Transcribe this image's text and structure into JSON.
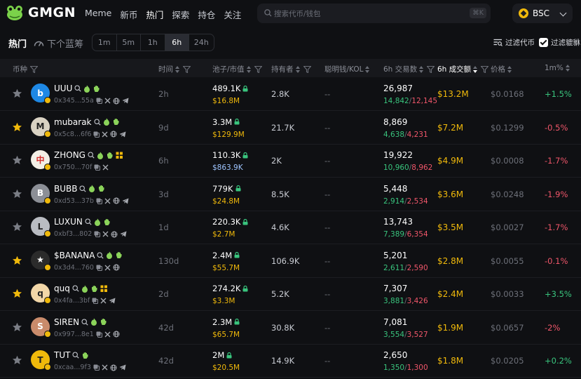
{
  "app": {
    "brand": "GMGN"
  },
  "nav": [
    "Meme",
    "新币",
    "热门",
    "探索",
    "持仓",
    "关注"
  ],
  "nav_active_index": 2,
  "search": {
    "placeholder": "搜索代币/钱包",
    "shortcut": "⌘K"
  },
  "chain": {
    "label": "BSC"
  },
  "subbar": {
    "tab_hot": "热门",
    "tab_next": "下个蓝筹",
    "time_filters": [
      "1m",
      "5m",
      "1h",
      "6h",
      "24h"
    ],
    "time_active": "6h",
    "filter_coins": "过滤代币",
    "filter_honeypot": "过滤貔貅",
    "filter_honeypot_checked": true
  },
  "columns": {
    "coin": "币种",
    "age": "时间",
    "liq_mcap": "池子/市值",
    "holders": "持有者",
    "smart_kol": "聪明钱/KOL",
    "txs": "6h 交易数",
    "volume": "6h 成交额",
    "price": "价格",
    "change": "1m%"
  },
  "colors": {
    "up": "#39c47d",
    "down": "#f0566a",
    "gold": "#f0b90b",
    "bg": "#0f1013"
  },
  "rows": [
    {
      "symbol": "UUU",
      "address": "0x345...55a",
      "age": "2h",
      "liquidity": "489.1K",
      "mcap": "$16.8M",
      "holders": "2.8K",
      "kol": "--",
      "txs": "26,987",
      "buys": "14,842",
      "sells": "12,145",
      "volume": "$13.2M",
      "price": "$0.0168",
      "change": "+1.5%",
      "change_dir": "up",
      "starred": false,
      "avatar_color": "#1e88e5",
      "avatar_text": "b"
    },
    {
      "symbol": "mubarak",
      "address": "0x5c8...6f6",
      "age": "9d",
      "liquidity": "3.3M",
      "mcap": "$129.9M",
      "holders": "21.7K",
      "kol": "--",
      "txs": "8,869",
      "buys": "4,638",
      "sells": "4,231",
      "volume": "$7.2M",
      "price": "$0.1299",
      "change": "-0.5%",
      "change_dir": "down",
      "starred": true,
      "avatar_color": "#d9d2c3",
      "avatar_text": "M"
    },
    {
      "symbol": "ZHONG",
      "address": "0x750...70f",
      "age": "6h",
      "liquidity": "110.3K",
      "mcap": "$863.9K",
      "mcap_blue": true,
      "holders": "2K",
      "kol": "--",
      "txs": "19,922",
      "buys": "10,960",
      "sells": "8,962",
      "volume": "$4.9M",
      "price": "$0.0008",
      "change": "-1.7%",
      "change_dir": "down",
      "starred": false,
      "avatar_color": "#f3efe6",
      "avatar_text": "中"
    },
    {
      "symbol": "BUBB",
      "address": "0xd53...37b",
      "age": "3d",
      "liquidity": "779K",
      "mcap": "$24.8M",
      "holders": "8.5K",
      "kol": "--",
      "txs": "5,448",
      "buys": "2,914",
      "sells": "2,534",
      "volume": "$3.6M",
      "price": "$0.0248",
      "change": "-1.9%",
      "change_dir": "down",
      "starred": false,
      "avatar_color": "#8c8f96",
      "avatar_text": "B"
    },
    {
      "symbol": "LUXUN",
      "address": "0xbf3...802",
      "age": "1d",
      "liquidity": "220.3K",
      "mcap": "$2.7M",
      "holders": "4.6K",
      "kol": "--",
      "txs": "13,743",
      "buys": "7,389",
      "sells": "6,354",
      "volume": "$3.5M",
      "price": "$0.0027",
      "change": "-1.7%",
      "change_dir": "down",
      "starred": false,
      "avatar_color": "#b9bcc2",
      "avatar_text": "L"
    },
    {
      "symbol": "$BANANA",
      "address": "0x3d4...760",
      "age": "130d",
      "liquidity": "2.4M",
      "mcap": "$55.7M",
      "holders": "106.9K",
      "kol": "--",
      "txs": "5,201",
      "buys": "2,611",
      "sells": "2,590",
      "volume": "$2.8M",
      "price": "$0.0055",
      "change": "-0.1%",
      "change_dir": "down",
      "starred": true,
      "avatar_color": "#2b2b2b",
      "avatar_text": "★"
    },
    {
      "symbol": "quq",
      "address": "0x4fa...3bf",
      "age": "2d",
      "liquidity": "274.2K",
      "mcap": "$3.3M",
      "holders": "5.2K",
      "kol": "--",
      "txs": "7,307",
      "buys": "3,881",
      "sells": "3,426",
      "volume": "$2.4M",
      "price": "$0.0033",
      "change": "+3.5%",
      "change_dir": "up",
      "starred": true,
      "avatar_color": "#f2d7a8",
      "avatar_text": "q"
    },
    {
      "symbol": "SIREN",
      "address": "0x997...8e1",
      "age": "42d",
      "liquidity": "2.3M",
      "mcap": "$65.7M",
      "holders": "30.8K",
      "kol": "--",
      "txs": "7,081",
      "buys": "3,554",
      "sells": "3,527",
      "volume": "$1.9M",
      "price": "$0.0657",
      "change": "-2%",
      "change_dir": "down",
      "starred": false,
      "avatar_color": "#c98b6b",
      "avatar_text": "S"
    },
    {
      "symbol": "TUT",
      "address": "0xcaa...9f3",
      "age": "42d",
      "liquidity": "2M",
      "mcap": "$20.5M",
      "holders": "14.9K",
      "kol": "--",
      "txs": "2,650",
      "buys": "1,350",
      "sells": "1,300",
      "volume": "$1.8M",
      "price": "$0.0205",
      "change": "+0.2%",
      "change_dir": "up",
      "starred": false,
      "avatar_color": "#f0b90b",
      "avatar_text": "T"
    }
  ]
}
